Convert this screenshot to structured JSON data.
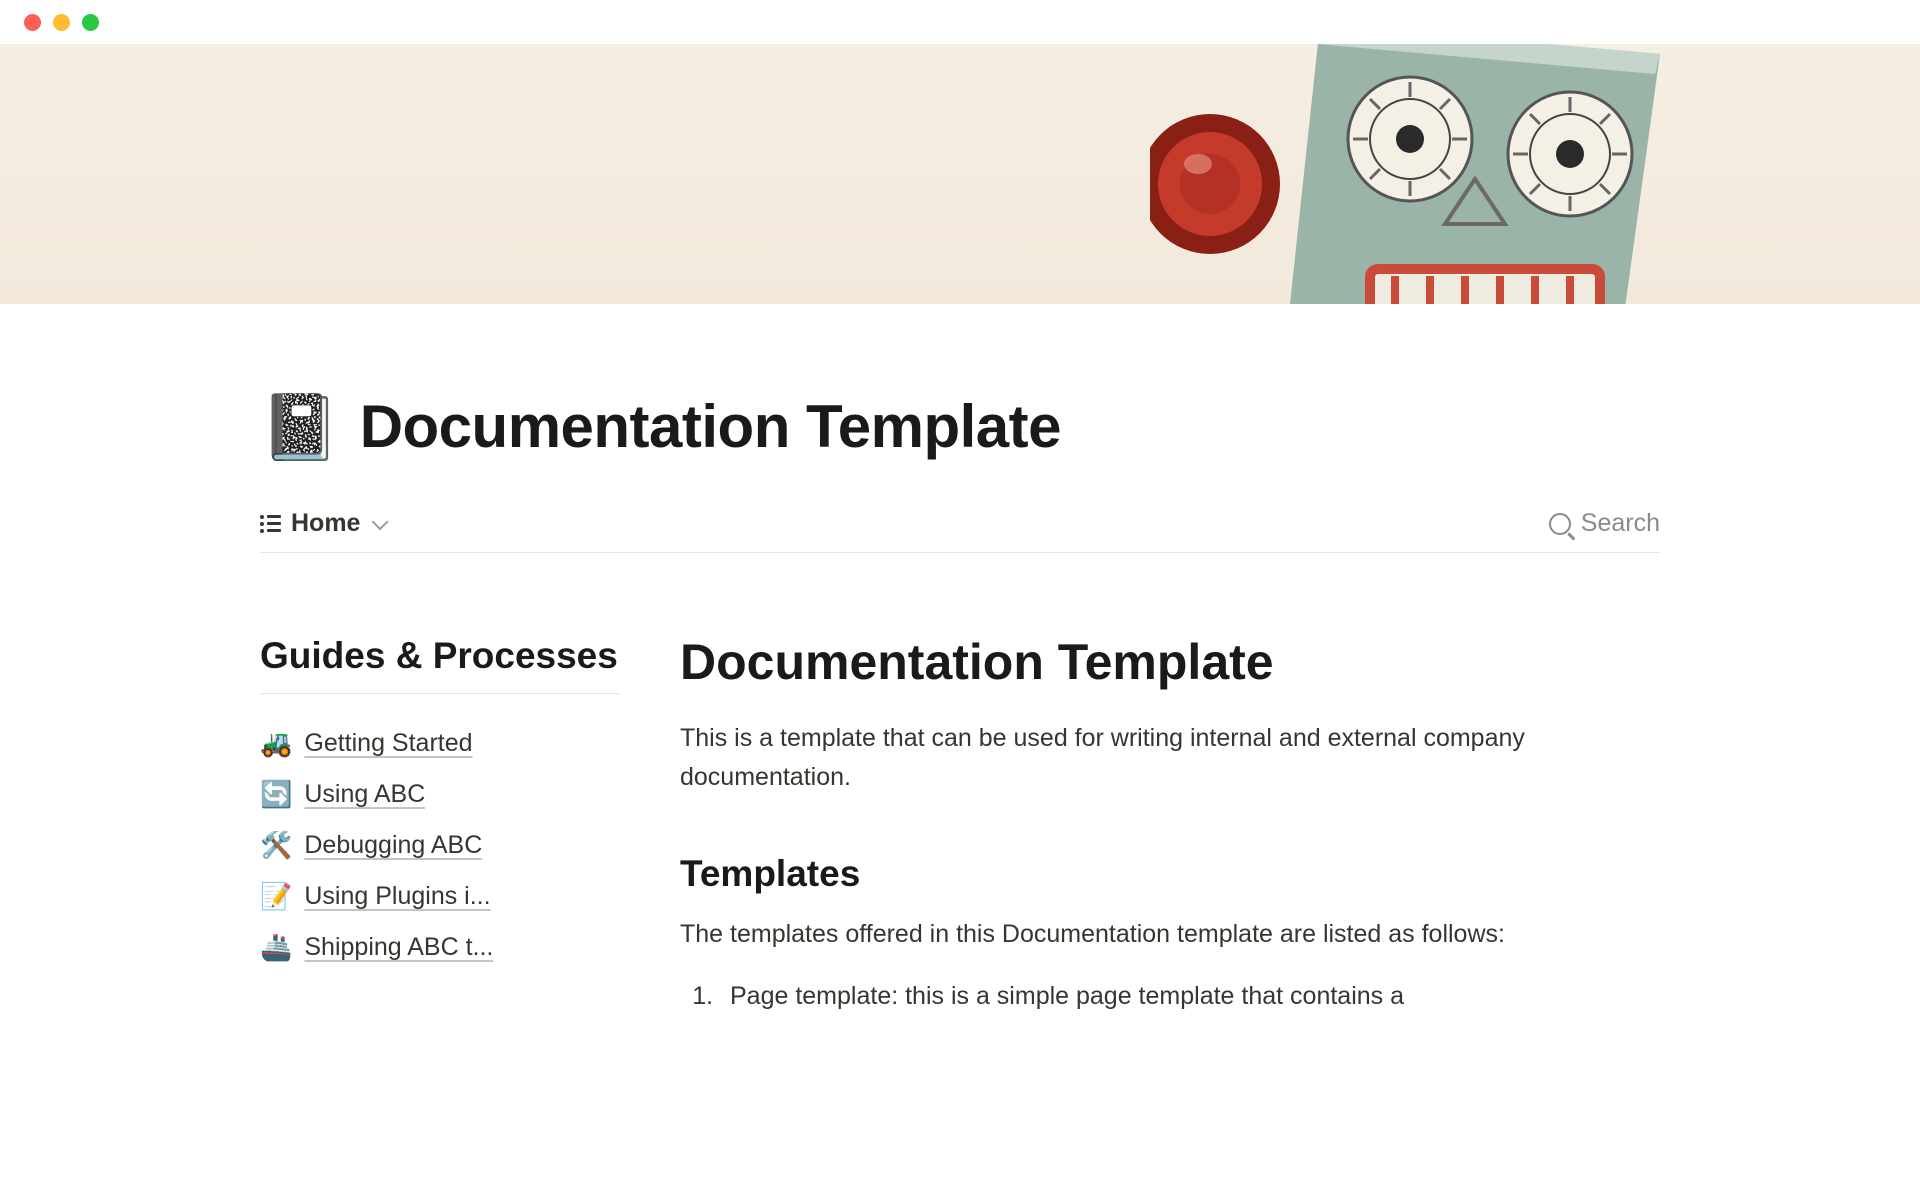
{
  "page": {
    "icon": "📓",
    "title": "Documentation Template"
  },
  "toolbar": {
    "view_name": "Home",
    "search_label": "Search"
  },
  "sidebar": {
    "heading": "Guides & Processes",
    "items": [
      {
        "emoji": "🚜",
        "label": "Getting Started"
      },
      {
        "emoji": "🔄",
        "label": "Using ABC"
      },
      {
        "emoji": "🛠️",
        "label": "Debugging ABC"
      },
      {
        "emoji": "📝",
        "label": "Using Plugins i..."
      },
      {
        "emoji": "🚢",
        "label": "Shipping ABC t..."
      }
    ]
  },
  "main": {
    "title": "Documentation Template",
    "intro": "This is a template that can be used for writing internal and external company documentation.",
    "subheading": "Templates",
    "templates_intro": "The templates offered in this Documentation template are listed as follows:",
    "list": [
      "Page template: this is a simple page template that contains a"
    ]
  }
}
